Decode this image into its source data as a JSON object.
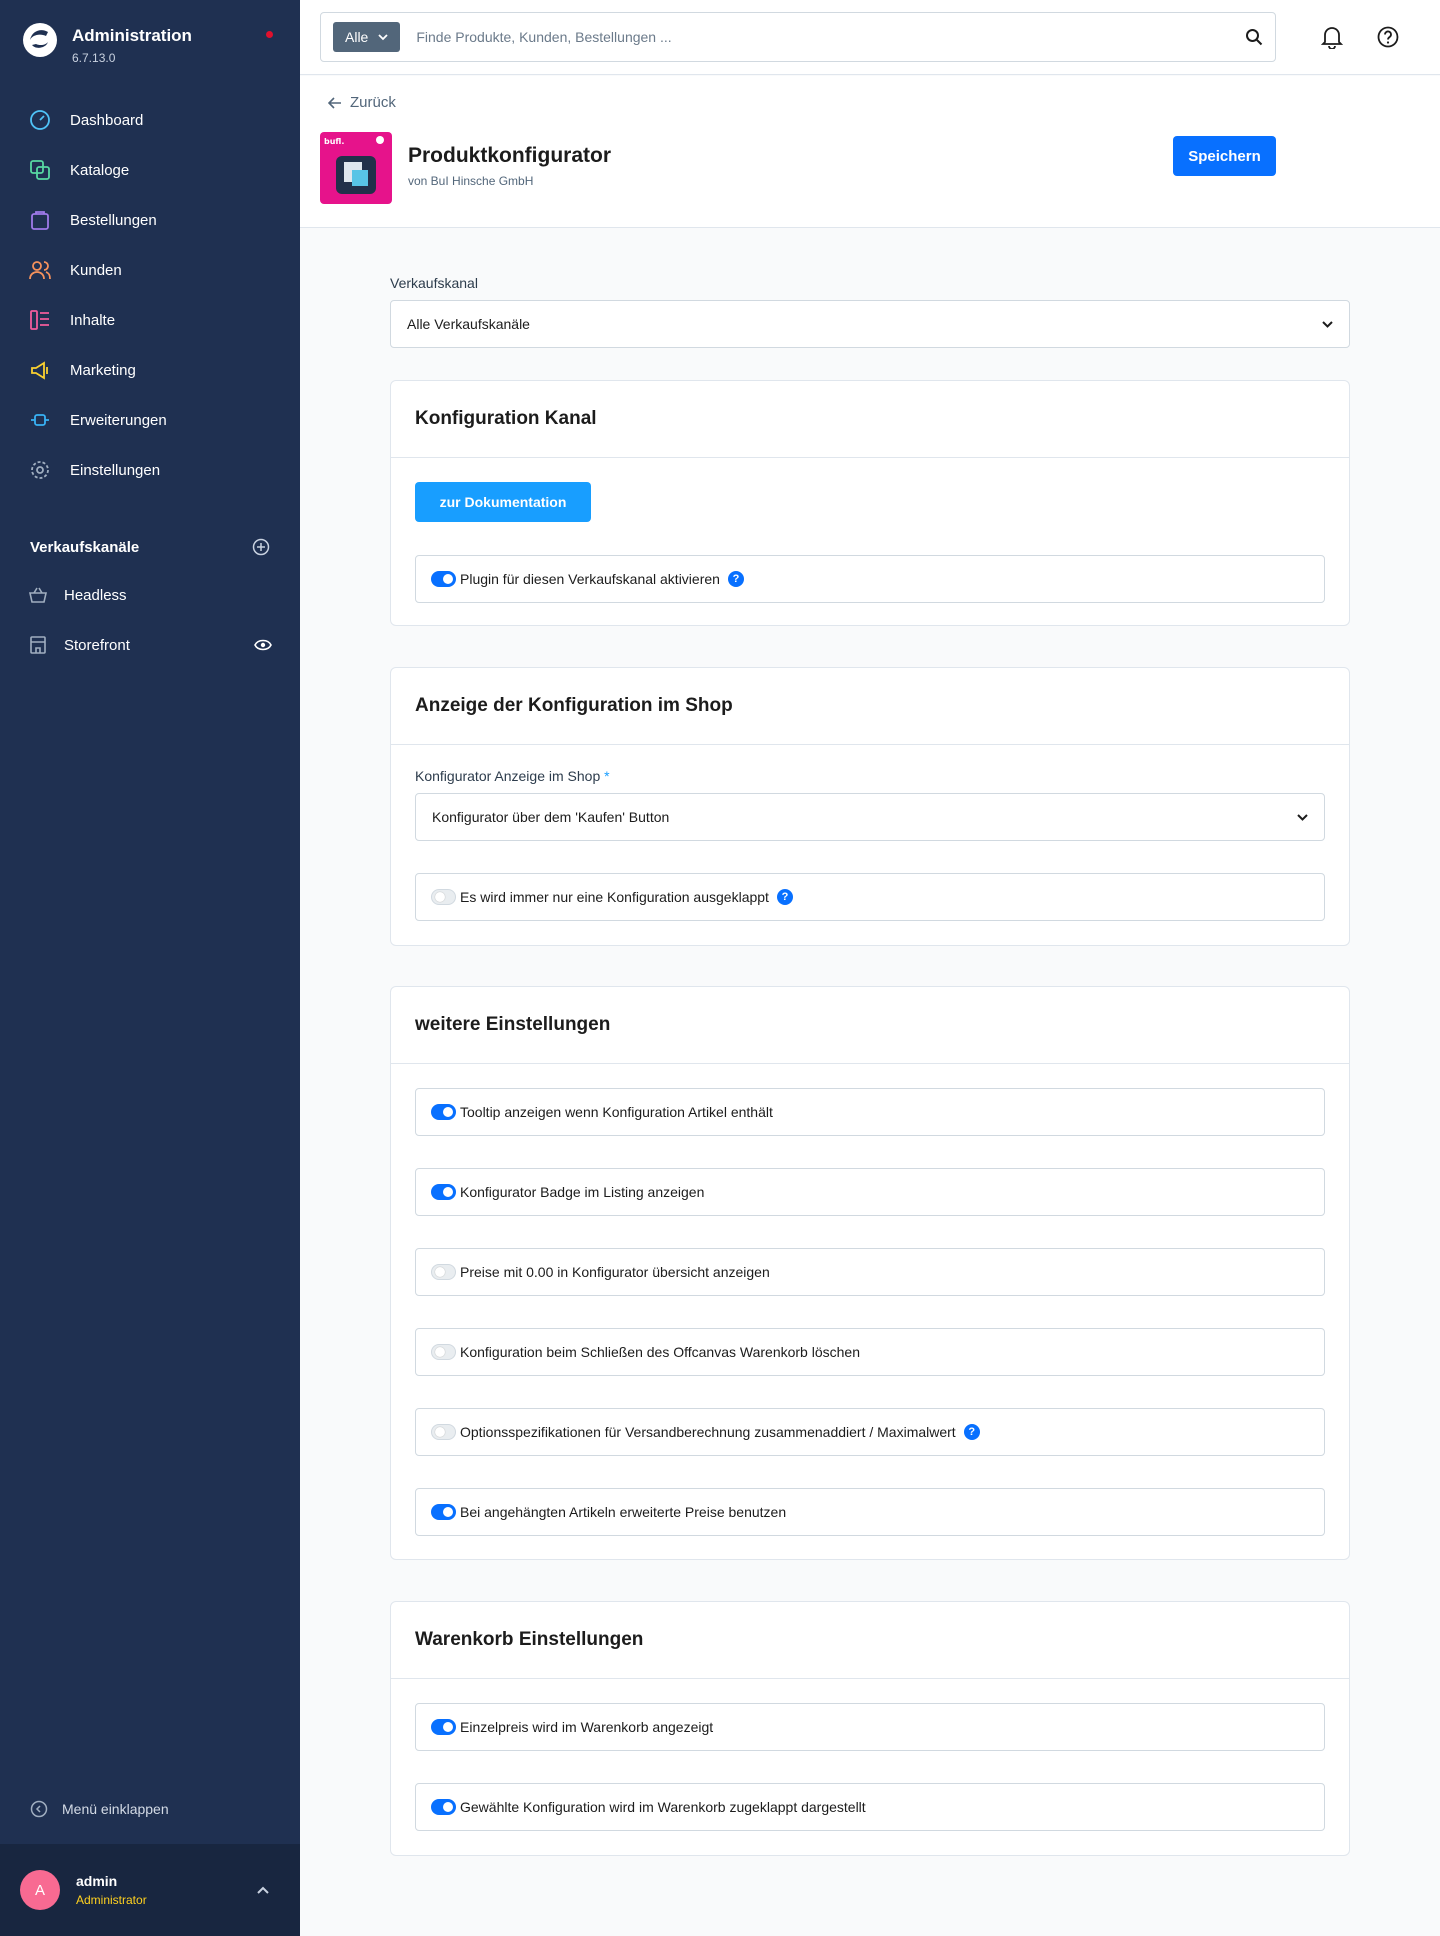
{
  "sidebar": {
    "title": "Administration",
    "version": "6.7.13.0",
    "nav": [
      {
        "label": "Dashboard",
        "icon": "dashboard-icon"
      },
      {
        "label": "Kataloge",
        "icon": "catalog-icon"
      },
      {
        "label": "Bestellungen",
        "icon": "orders-icon"
      },
      {
        "label": "Kunden",
        "icon": "customers-icon"
      },
      {
        "label": "Inhalte",
        "icon": "content-icon"
      },
      {
        "label": "Marketing",
        "icon": "marketing-icon"
      },
      {
        "label": "Erweiterungen",
        "icon": "extensions-icon"
      },
      {
        "label": "Einstellungen",
        "icon": "settings-icon"
      }
    ],
    "sales_channels_title": "Verkaufskanäle",
    "sales_channels": [
      {
        "label": "Headless",
        "icon": "basket-icon"
      },
      {
        "label": "Storefront",
        "icon": "storefront-icon"
      }
    ],
    "collapse_label": "Menü einklappen",
    "user": {
      "initial": "A",
      "name": "admin",
      "role": "Administrator"
    }
  },
  "search": {
    "type": "Alle",
    "placeholder": "Finde Produkte, Kunden, Bestellungen ..."
  },
  "header": {
    "back": "Zurück",
    "app_title": "Produktkonfigurator",
    "app_vendor": "von BuI Hinsche GmbH",
    "save": "Speichern"
  },
  "sales_channel_field": {
    "label": "Verkaufskanal",
    "value": "Alle Verkaufskanäle"
  },
  "cards": {
    "channel": {
      "title": "Konfiguration Kanal",
      "doc_button": "zur Dokumentation",
      "toggle": {
        "label": "Plugin für diesen Verkaufskanal aktivieren",
        "on": true
      }
    },
    "display": {
      "title": "Anzeige der Konfiguration im Shop",
      "select_label": "Konfigurator Anzeige im Shop",
      "required_mark": "*",
      "select_value": "Konfigurator über dem 'Kaufen' Button",
      "toggle": {
        "label": "Es wird immer nur eine Konfiguration ausgeklappt",
        "on": false
      }
    },
    "more": {
      "title": "weitere Einstellungen",
      "toggles": [
        {
          "label": "Tooltip anzeigen wenn Konfiguration Artikel enthält",
          "on": true
        },
        {
          "label": "Konfigurator Badge im Listing anzeigen",
          "on": true
        },
        {
          "label": "Preise mit 0.00 in Konfigurator übersicht anzeigen",
          "on": false
        },
        {
          "label": "Konfiguration beim Schließen des Offcanvas Warenkorb löschen",
          "on": false
        },
        {
          "label": "Optionsspezifikationen für Versandberechnung zusammenaddiert / Maximalwert",
          "on": false
        },
        {
          "label": "Bei angehängten Artikeln erweiterte Preise benutzen",
          "on": true
        }
      ]
    },
    "cart": {
      "title": "Warenkorb Einstellungen",
      "toggles": [
        {
          "label": "Einzelpreis wird im Warenkorb angezeigt",
          "on": true
        },
        {
          "label": "Gewählte Konfiguration wird im Warenkorb zugeklappt dargestellt",
          "on": true
        }
      ]
    }
  },
  "app_badge_text": "bufl.",
  "help_glyph": "?",
  "colors": {
    "sidebar": "#1f3051",
    "primary": "#0870ff",
    "doc_button": "#189eff",
    "app_icon": "#e6138b",
    "user_role": "#ffd11f"
  }
}
